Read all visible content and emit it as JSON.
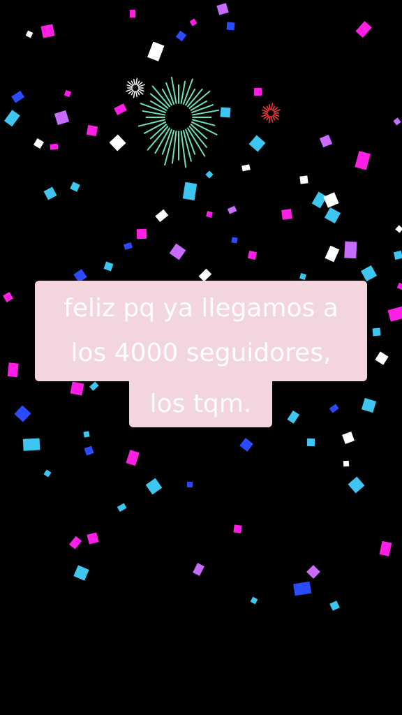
{
  "scene": {
    "description_free": true,
    "confetti_colors": [
      "#ff1ee6",
      "#2a4bff",
      "#3ec6f0",
      "#ffffff",
      "#c86cff",
      "#ff4fa0"
    ],
    "firework_colors": [
      "#6ee0b8",
      "#ff3b3b",
      "#ffffff"
    ]
  },
  "caption": {
    "line1": "feliz pq ya llegamos a",
    "line2": "los 4000 seguidores,",
    "line3": "los tqm."
  },
  "colors": {
    "caption_bg": "#f3d5de",
    "caption_text": "#ffffff",
    "background": "#000000"
  }
}
